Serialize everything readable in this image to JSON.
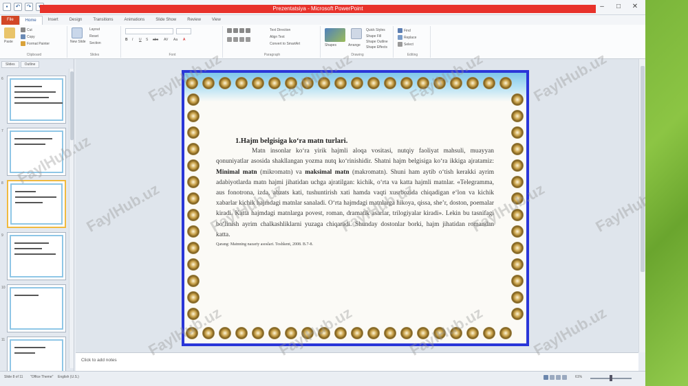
{
  "window": {
    "title": "Prezentatsiya - Microsoft PowerPoint",
    "qat_icons": [
      "save-icon",
      "undo-icon",
      "redo-icon",
      "customize-icon"
    ],
    "controls": [
      "minimize-icon",
      "maximize-icon",
      "close-icon"
    ]
  },
  "ribbon": {
    "tabs": [
      "File",
      "Home",
      "Insert",
      "Design",
      "Transitions",
      "Animations",
      "Slide Show",
      "Review",
      "View"
    ],
    "active_tab": "Home",
    "groups": [
      {
        "label": "Clipboard",
        "buttons": [
          "Paste",
          "Cut",
          "Copy",
          "Format Painter"
        ]
      },
      {
        "label": "Slides",
        "buttons": [
          "New Slide",
          "Layout",
          "Reset",
          "Section"
        ]
      },
      {
        "label": "Font",
        "buttons": [
          "B",
          "I",
          "U",
          "S",
          "abc",
          "AV",
          "Aa",
          "A"
        ]
      },
      {
        "label": "Paragraph",
        "buttons": [
          "Text Direction",
          "Align Text",
          "Convert to SmartArt"
        ]
      },
      {
        "label": "Drawing",
        "buttons": [
          "Shapes",
          "Arrange",
          "Quick Styles",
          "Shape Fill",
          "Shape Outline",
          "Shape Effects"
        ]
      },
      {
        "label": "Editing",
        "buttons": [
          "Find",
          "Replace",
          "Select"
        ]
      }
    ]
  },
  "thumbnails": {
    "tabs": [
      "Slides",
      "Outline"
    ],
    "items": [
      {
        "num": "6"
      },
      {
        "num": "7"
      },
      {
        "num": "8"
      },
      {
        "num": "9"
      },
      {
        "num": "10"
      },
      {
        "num": "11"
      }
    ],
    "selected_index": 2
  },
  "slide": {
    "title": "1.Hajm belgisiga ko‘ra matn turlari.",
    "body_parts": [
      {
        "text": "Matn insonlar ko‘ra yirik hajmli aloqa vositasi, nutqiy faoliyat mahsuli, muayyan qonuniyatlar asosida shakllangan yozma nutq ko‘rinishidir. Shatni hajm belgisiga ko‘ra ikkiga ajratamiz: ",
        "bold": false
      },
      {
        "text": "Minimal matn",
        "bold": true
      },
      {
        "text": " (mikromatn) va ",
        "bold": false
      },
      {
        "text": "maksimal matn",
        "bold": true
      },
      {
        "text": " (makromatn). Shuni ham aytib o‘tish kerakki ayrim adabiyotlarda matn hajmi jihatidan uchga ajratilgan: kichik, o‘rta va katta hajmli matnlar. «Telegramma, aus fonotrona, izda, abzats kati, tushuntirish xati hamda vaqti xusrbozida chiqadigan e‘lon va kichik xabarlar kichik hajmdagi matnlar sanaladi. O‘rta hajmdagi matnlarga hikoya, qissa, she’r, doston, poemalar kiradi. Katta hajmdagi matnlarga povest, roman, dramatik asarlar, trilogiyalar kiradi». Lekin bu tasnifagi bo‘linish ayrim chalkashliklarni yuzaga chiqaradi. Shunday dostonlar borki, hajm jihatidan romandan katta.",
        "bold": false
      }
    ],
    "reference": "Qarang: Matnning nazariy asoslari. Toshkent, 2008. B.7-8."
  },
  "notes": {
    "placeholder": "Click to add notes"
  },
  "statusbar": {
    "slide_info": "Slide 8 of 11",
    "theme": "\"Office Theme\"",
    "language": "English (U.S.)",
    "zoom": "61%",
    "view_icons": [
      "normal-view-icon",
      "slide-sorter-icon",
      "reading-view-icon",
      "slideshow-icon"
    ]
  },
  "watermark": {
    "text": "FaylHub.uz",
    "color": "#969696"
  },
  "colors": {
    "title_bar_red": "#e8322b",
    "file_tab": "#d24726",
    "slide_border": "#2a36d8",
    "selected_thumb": "#f0b93e"
  }
}
